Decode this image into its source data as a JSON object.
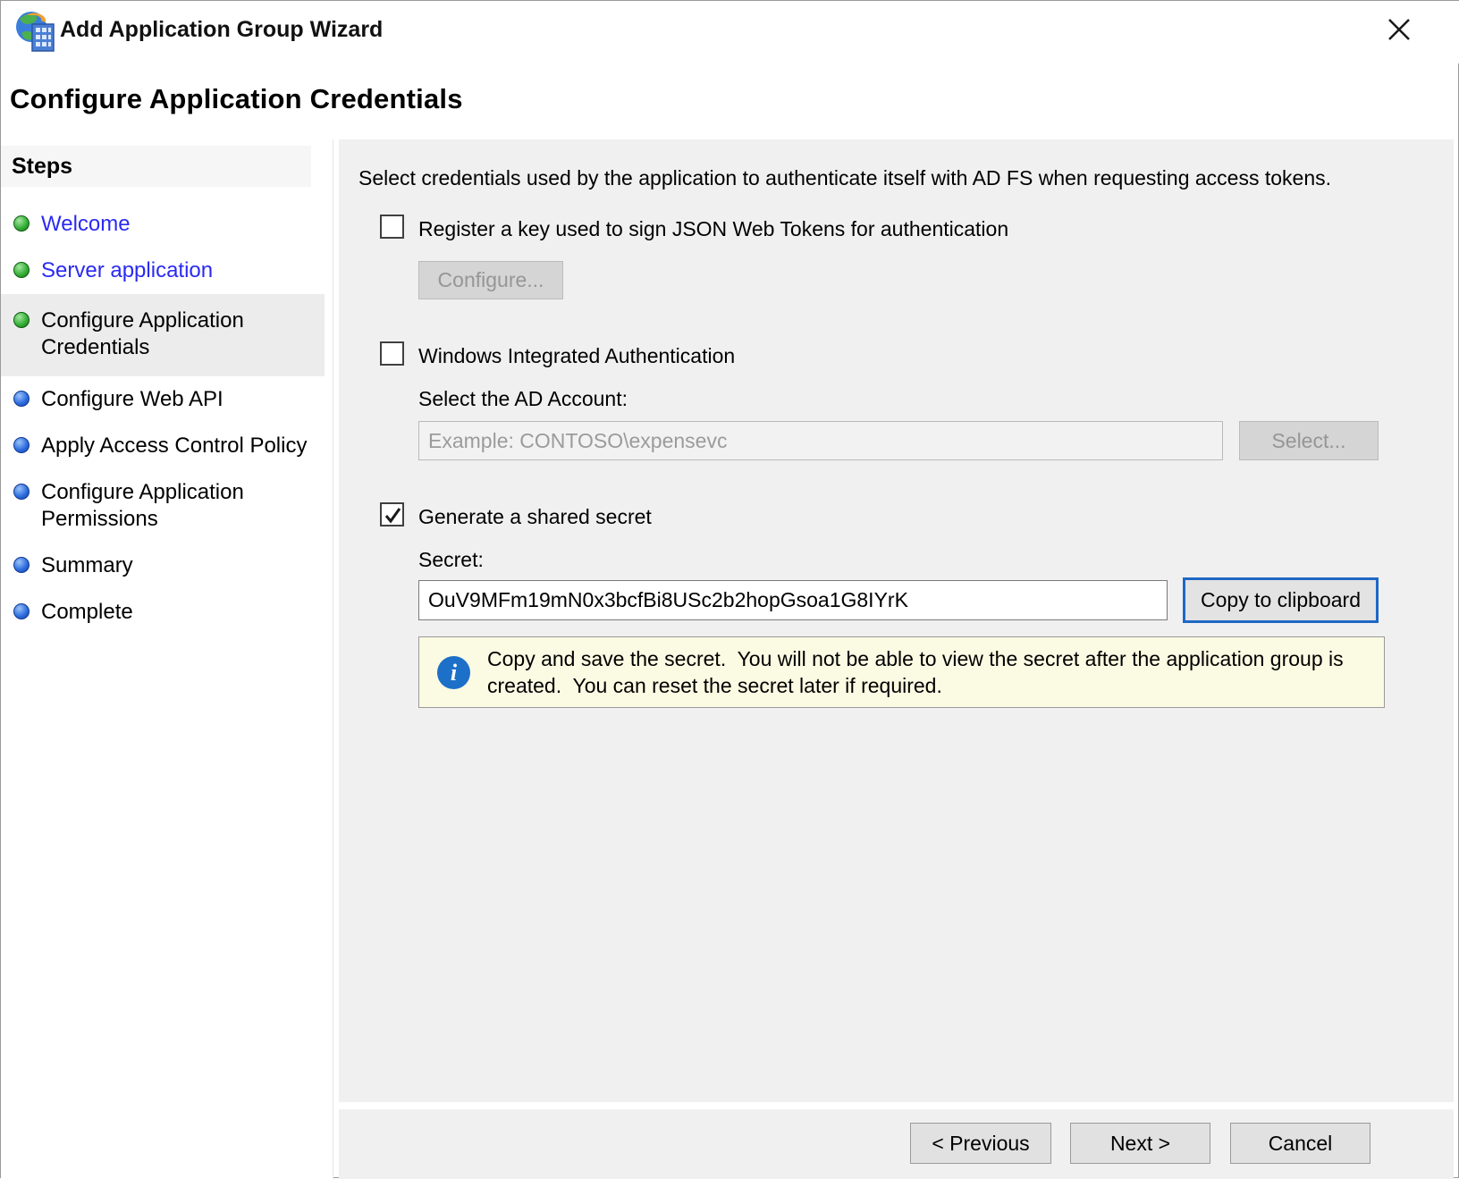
{
  "window": {
    "title": "Add Application Group Wizard",
    "page_title": "Configure Application Credentials"
  },
  "sidebar": {
    "heading": "Steps",
    "items": [
      {
        "label": "Welcome",
        "status": "done",
        "link": true,
        "current": false
      },
      {
        "label": "Server application",
        "status": "done",
        "link": true,
        "current": false
      },
      {
        "label": "Configure Application Credentials",
        "status": "done",
        "link": false,
        "current": true
      },
      {
        "label": "Configure Web API",
        "status": "todo",
        "link": false,
        "current": false
      },
      {
        "label": "Apply Access Control Policy",
        "status": "todo",
        "link": false,
        "current": false
      },
      {
        "label": "Configure Application Permissions",
        "status": "todo",
        "link": false,
        "current": false
      },
      {
        "label": "Summary",
        "status": "todo",
        "link": false,
        "current": false
      },
      {
        "label": "Complete",
        "status": "todo",
        "link": false,
        "current": false
      }
    ]
  },
  "main": {
    "intro": "Select credentials used by the application to authenticate itself with AD FS when requesting access tokens.",
    "register_key": {
      "label": "Register a key used to sign JSON Web Tokens for authentication",
      "checked": false,
      "configure_button": "Configure...",
      "configure_enabled": false
    },
    "windows_integrated_auth": {
      "label": "Windows Integrated Authentication",
      "checked": false,
      "account_label": "Select the AD Account:",
      "account_placeholder": "Example: CONTOSO\\expensevc",
      "account_enabled": false,
      "select_button": "Select...",
      "select_enabled": false
    },
    "shared_secret": {
      "label": "Generate a shared secret",
      "checked": true,
      "secret_label": "Secret:",
      "secret_value": "OuV9MFm19mN0x3bcfBi8USc2b2hopGsoa1G8IYrK",
      "copy_button": "Copy to clipboard",
      "notice": "Copy and save the secret.  You will not be able to view the secret after the application group is created.  You can reset the secret later if required."
    }
  },
  "footer": {
    "previous": "< Previous",
    "next": "Next >",
    "cancel": "Cancel"
  },
  "colors": {
    "panel_bg": "#f0f0f0",
    "step_link": "#2a2af2",
    "step_done_dot": "#38b03a",
    "step_todo_dot": "#2f6fe0",
    "focus_border": "#1f68c5",
    "notice_bg": "#fbfbe3",
    "info_icon": "#1d70c8"
  }
}
